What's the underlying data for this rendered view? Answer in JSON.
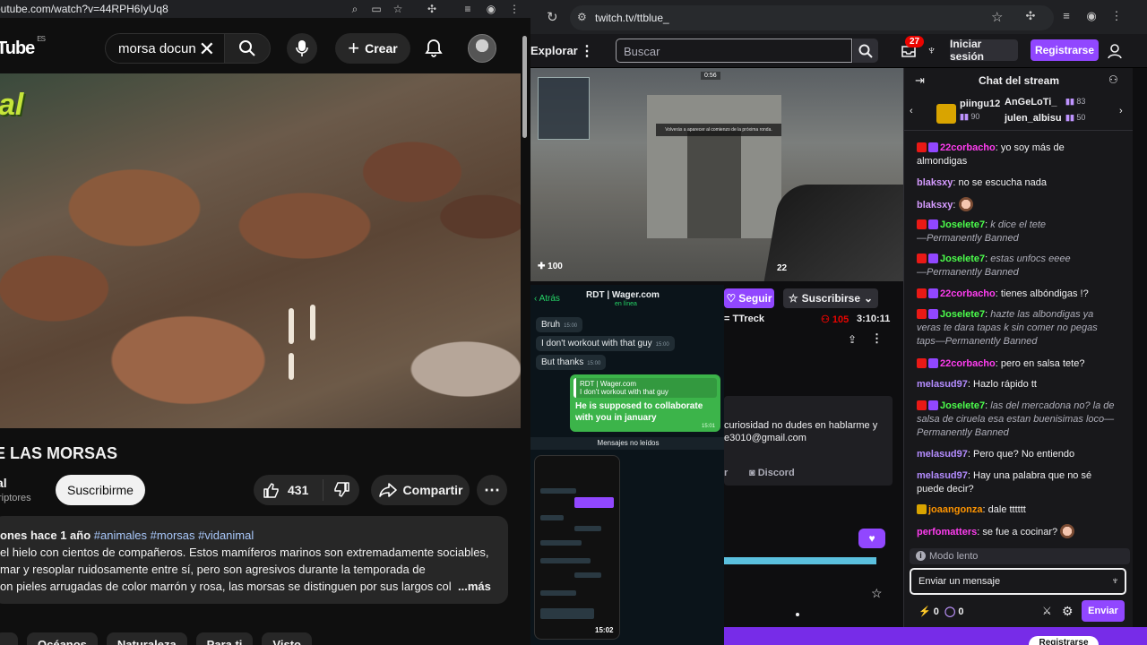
{
  "youtube": {
    "url": "outube.com/watch?v=44RPH6IyUq8",
    "logo": "Tube",
    "logo_region": "ES",
    "search_value": "morsa docun",
    "create_label": "Crear",
    "video_title": "E LAS MORSAS",
    "channel_name": "al",
    "subs_text": "riptores",
    "subscribe_label": "Suscribirme",
    "likes": "431",
    "share_label": "Compartir",
    "description": {
      "meta": "ones  hace 1 año",
      "tags": "#animales #morsas #vidanimal",
      "line1": "el hielo con cientos de compañeros. Estos mamíferos marinos son extremadamente sociables,",
      "line2": "mar y resoplar ruidosamente entre sí, pero son agresivos durante la temporada de",
      "line3": "on pieles arrugadas de color marrón y rosa, las morsas se distinguen por sus largos col",
      "more": "...más"
    },
    "chips": [
      "",
      "Océanos",
      "Naturaleza",
      "Para ti",
      "Visto"
    ],
    "video_brand": "al"
  },
  "twitch": {
    "url": "twitch.tv/ttblue_",
    "nav": {
      "explore": "Explorar",
      "search_placeholder": "Buscar",
      "notifications": "27",
      "login": "Iniciar sesión",
      "signup": "Registrarse"
    },
    "channel": {
      "follow": "Seguir",
      "subscribe": "Suscribirse",
      "game": "= TTreck",
      "viewers": "105",
      "uptime": "3:10:11",
      "about_line1": "curiosidad no dudes en hablarme y",
      "about_line2": "e3010@gmail.com",
      "about_link1": "r",
      "discord": "Discord"
    },
    "player": {
      "health": "100",
      "ammo": "22",
      "timer": "0:56",
      "banner": "Volverás a aparecer al comienzo de la próxima ronda."
    },
    "whatsapp": {
      "back": "Atrás",
      "contact": "RDT | Wager.com",
      "status": "en línea",
      "messages": [
        {
          "text": "Bruh",
          "time": "15:00"
        },
        {
          "text": "I don't workout with that guy",
          "time": "15:00"
        },
        {
          "text": "But thanks",
          "time": "15:00"
        }
      ],
      "reply_quote_name": "RDT | Wager.com",
      "reply_quote_text": "I don't workout with that guy",
      "reply_line1": "He is supposed to collaborate",
      "reply_line2": "with you in january",
      "reply_time": "15:01",
      "unread": "Mensajes no leídos",
      "clock": "15:02"
    },
    "chat": {
      "title": "Chat del stream",
      "leaders": [
        {
          "name": "piingu12",
          "bits": "90"
        },
        {
          "name": "AnGeLoTi_",
          "bits": "83"
        },
        {
          "name": "julen_albisu",
          "bits": "50"
        }
      ],
      "messages": [
        {
          "user": "22corbacho",
          "color": "#ff3df0",
          "text": "yo soy más de almondigas",
          "ban": ""
        },
        {
          "user": "blaksxy",
          "color": "#d59bff",
          "text": "no se escucha nada",
          "ban": ""
        },
        {
          "user": "blaksxy",
          "color": "#d59bff",
          "text": "",
          "ban": ""
        },
        {
          "user": "Joselete7",
          "color": "#4cff4c",
          "text": "k dice el tete",
          "ban": "—Permanently Banned"
        },
        {
          "user": "Joselete7",
          "color": "#4cff4c",
          "text": "estas unfocs eeee",
          "ban": "—Permanently Banned"
        },
        {
          "user": "22corbacho",
          "color": "#ff3df0",
          "text": "tienes albóndigas !?",
          "ban": ""
        },
        {
          "user": "Joselete7",
          "color": "#4cff4c",
          "text": "hazte las albondigas ya veras te dara tapas k sin comer no pegas taps",
          "ban": "—Permanently Banned"
        },
        {
          "user": "22corbacho",
          "color": "#ff3df0",
          "text": "pero en salsa tete?",
          "ban": ""
        },
        {
          "user": "melasud97",
          "color": "#b48cff",
          "text": "Hazlo rápido tt",
          "ban": ""
        },
        {
          "user": "Joselete7",
          "color": "#4cff4c",
          "text": "las del mercadona no? la de salsa de ciruela esa estan buenisimas loco",
          "ban": "—Permanently Banned"
        },
        {
          "user": "melasud97",
          "color": "#b48cff",
          "text": "Pero que? No entiendo",
          "ban": ""
        },
        {
          "user": "melasud97",
          "color": "#b48cff",
          "text": "Hay una palabra que no sé puede decir?",
          "ban": ""
        },
        {
          "user": "joaangonza",
          "color": "#ff9500",
          "text": "dale tttttt",
          "ban": ""
        },
        {
          "user": "perfomatters",
          "color": "#ff3df0",
          "text": "se fue a cocinar?",
          "ban": ""
        }
      ],
      "slow_mode": "Modo lento",
      "input_placeholder": "Enviar un mensaje",
      "points_a": "0",
      "points_b": "0",
      "send": "Enviar"
    },
    "bottom_button": "Registrarse"
  },
  "colors": {
    "twitch_purple": "#9147ff",
    "youtube_bg": "#0f0f0f"
  }
}
